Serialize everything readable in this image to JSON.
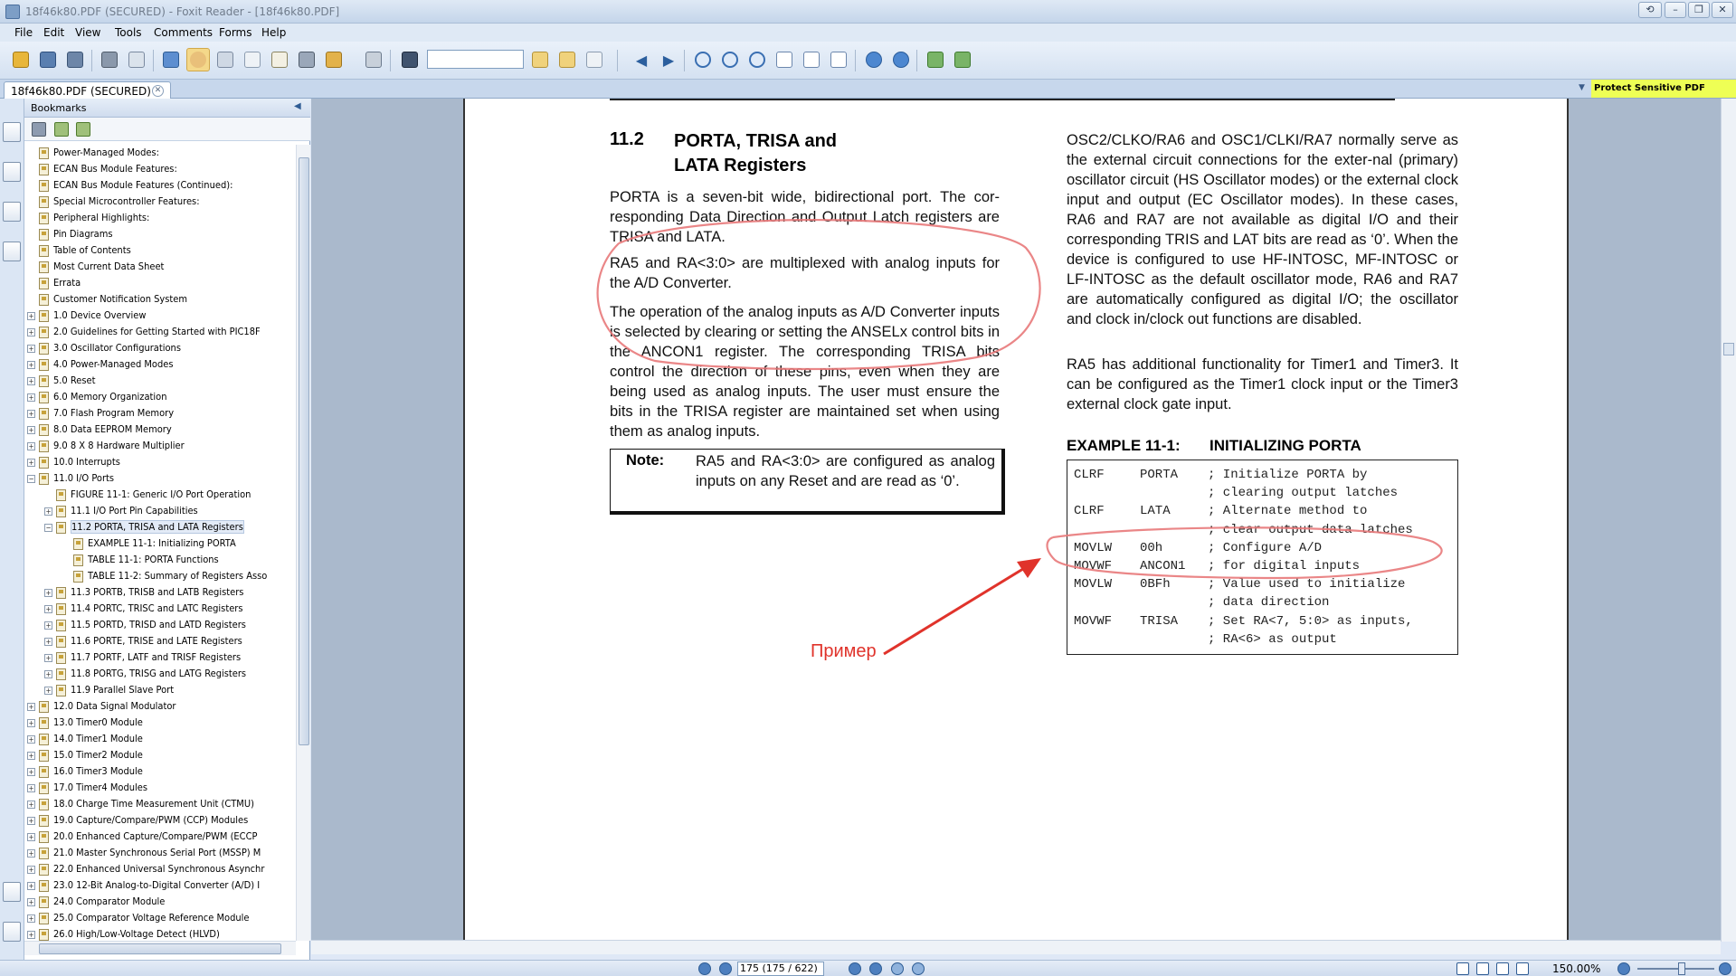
{
  "window": {
    "title": "18f46k80.PDF (SECURED) - Foxit Reader - [18f46k80.PDF]",
    "controls": [
      "⟲",
      "–",
      "❐",
      "✕"
    ]
  },
  "menu": [
    "File",
    "Edit",
    "View",
    "Tools",
    "Comments",
    "Forms",
    "Help"
  ],
  "tab": {
    "label": "18f46k80.PDF (SECURED)",
    "close": "✕",
    "dropdown": "▼"
  },
  "promo": "Protect Sensitive PDF Documents",
  "bookmarks": {
    "header": "Bookmarks",
    "items": [
      {
        "label": "Power-Managed Modes:",
        "level": 1,
        "exp": "",
        "sel": false
      },
      {
        "label": "ECAN Bus Module Features:",
        "level": 1,
        "exp": "",
        "sel": false
      },
      {
        "label": "ECAN Bus Module Features (Continued):",
        "level": 1,
        "exp": "",
        "sel": false
      },
      {
        "label": "Special Microcontroller Features:",
        "level": 1,
        "exp": "",
        "sel": false
      },
      {
        "label": "Peripheral Highlights:",
        "level": 1,
        "exp": "",
        "sel": false
      },
      {
        "label": "Pin Diagrams",
        "level": 1,
        "exp": "",
        "sel": false
      },
      {
        "label": "Table of Contents",
        "level": 1,
        "exp": "",
        "sel": false
      },
      {
        "label": "Most Current Data Sheet",
        "level": 1,
        "exp": "",
        "sel": false
      },
      {
        "label": "Errata",
        "level": 1,
        "exp": "",
        "sel": false
      },
      {
        "label": "Customer Notification System",
        "level": 1,
        "exp": "",
        "sel": false
      },
      {
        "label": "1.0 Device Overview",
        "level": 1,
        "exp": "+",
        "sel": false
      },
      {
        "label": "2.0 Guidelines for Getting Started with PIC18F",
        "level": 1,
        "exp": "+",
        "sel": false
      },
      {
        "label": "3.0 Oscillator Configurations",
        "level": 1,
        "exp": "+",
        "sel": false
      },
      {
        "label": "4.0 Power-Managed Modes",
        "level": 1,
        "exp": "+",
        "sel": false
      },
      {
        "label": "5.0 Reset",
        "level": 1,
        "exp": "+",
        "sel": false
      },
      {
        "label": "6.0 Memory Organization",
        "level": 1,
        "exp": "+",
        "sel": false
      },
      {
        "label": "7.0 Flash Program Memory",
        "level": 1,
        "exp": "+",
        "sel": false
      },
      {
        "label": "8.0 Data EEPROM Memory",
        "level": 1,
        "exp": "+",
        "sel": false
      },
      {
        "label": "9.0 8 X 8 Hardware Multiplier",
        "level": 1,
        "exp": "+",
        "sel": false
      },
      {
        "label": "10.0 Interrupts",
        "level": 1,
        "exp": "+",
        "sel": false
      },
      {
        "label": "11.0 I/O Ports",
        "level": 1,
        "exp": "−",
        "sel": false
      },
      {
        "label": "FIGURE 11-1: Generic I/O Port Operation",
        "level": 2,
        "exp": "",
        "sel": false
      },
      {
        "label": "11.1 I/O Port Pin Capabilities",
        "level": 2,
        "exp": "+",
        "sel": false
      },
      {
        "label": "11.2 PORTA, TRISA and LATA Registers",
        "level": 2,
        "exp": "−",
        "sel": true
      },
      {
        "label": "EXAMPLE 11-1: Initializing PORTA",
        "level": 3,
        "exp": "",
        "sel": false
      },
      {
        "label": "TABLE 11-1: PORTA Functions",
        "level": 3,
        "exp": "",
        "sel": false
      },
      {
        "label": "TABLE 11-2: Summary of Registers Asso",
        "level": 3,
        "exp": "",
        "sel": false
      },
      {
        "label": "11.3 PORTB, TRISB and LATB Registers",
        "level": 2,
        "exp": "+",
        "sel": false
      },
      {
        "label": "11.4 PORTC, TRISC and LATC Registers",
        "level": 2,
        "exp": "+",
        "sel": false
      },
      {
        "label": "11.5 PORTD, TRISD and LATD Registers",
        "level": 2,
        "exp": "+",
        "sel": false
      },
      {
        "label": "11.6 PORTE, TRISE and LATE Registers",
        "level": 2,
        "exp": "+",
        "sel": false
      },
      {
        "label": "11.7 PORTF, LATF and TRISF Registers",
        "level": 2,
        "exp": "+",
        "sel": false
      },
      {
        "label": "11.8 PORTG, TRISG and LATG Registers",
        "level": 2,
        "exp": "+",
        "sel": false
      },
      {
        "label": "11.9 Parallel Slave Port",
        "level": 2,
        "exp": "+",
        "sel": false
      },
      {
        "label": "12.0 Data Signal Modulator",
        "level": 1,
        "exp": "+",
        "sel": false
      },
      {
        "label": "13.0 Timer0 Module",
        "level": 1,
        "exp": "+",
        "sel": false
      },
      {
        "label": "14.0 Timer1 Module",
        "level": 1,
        "exp": "+",
        "sel": false
      },
      {
        "label": "15.0 Timer2 Module",
        "level": 1,
        "exp": "+",
        "sel": false
      },
      {
        "label": "16.0 Timer3 Module",
        "level": 1,
        "exp": "+",
        "sel": false
      },
      {
        "label": "17.0 Timer4 Modules",
        "level": 1,
        "exp": "+",
        "sel": false
      },
      {
        "label": "18.0 Charge Time Measurement Unit (CTMU)",
        "level": 1,
        "exp": "+",
        "sel": false
      },
      {
        "label": "19.0 Capture/Compare/PWM (CCP) Modules",
        "level": 1,
        "exp": "+",
        "sel": false
      },
      {
        "label": "20.0 Enhanced Capture/Compare/PWM (ECCP",
        "level": 1,
        "exp": "+",
        "sel": false
      },
      {
        "label": "21.0 Master Synchronous Serial Port (MSSP) M",
        "level": 1,
        "exp": "+",
        "sel": false
      },
      {
        "label": "22.0 Enhanced Universal Synchronous Asynchr",
        "level": 1,
        "exp": "+",
        "sel": false
      },
      {
        "label": "23.0 12-Bit Analog-to-Digital Converter (A/D) I",
        "level": 1,
        "exp": "+",
        "sel": false
      },
      {
        "label": "24.0 Comparator Module",
        "level": 1,
        "exp": "+",
        "sel": false
      },
      {
        "label": "25.0 Comparator Voltage Reference Module",
        "level": 1,
        "exp": "+",
        "sel": false
      },
      {
        "label": "26.0 High/Low-Voltage Detect (HLVD)",
        "level": 1,
        "exp": "+",
        "sel": false
      }
    ]
  },
  "document": {
    "heading_num": "11.2",
    "heading_line1": "PORTA, TRISA and",
    "heading_line2": "LATA Registers",
    "left_p1": "PORTA is a seven-bit wide, bidirectional port. The cor-responding Data Direction and Output Latch registers are TRISA and LATA.",
    "left_p2": "RA5 and RA<3:0> are multiplexed with analog inputs for the A/D Converter.",
    "left_p3": "The operation of the analog inputs as A/D Converter inputs is selected by clearing or setting the ANSELx control bits in the ANCON1 register. The corresponding TRISA bits control the direction of these pins, even when they are being used as analog inputs. The user must ensure the bits in the TRISA register are maintained set when using them as analog inputs.",
    "note_label": "Note:",
    "note_text": "RA5 and RA<3:0> are configured as analog inputs on any Reset and are read as ‘0’.",
    "right_p1": "OSC2/CLKO/RA6 and OSC1/CLKI/RA7 normally serve as the external circuit connections for the exter-nal (primary) oscillator circuit (HS Oscillator modes) or the external clock input and output (EC Oscillator modes). In these cases, RA6 and RA7 are not available as digital I/O and their corresponding TRIS and LAT bits are read as ‘0’. When the device is configured to use HF-INTOSC, MF-INTOSC or LF-INTOSC as the default oscillator mode, RA6 and RA7 are automatically configured as digital I/O; the oscillator and clock in/clock out functions are disabled.",
    "right_p2": "RA5 has additional functionality for Timer1 and Timer3. It can be configured as the Timer1 clock input or the Timer3 external clock gate input.",
    "example_label": "EXAMPLE 11-1:",
    "example_title": "INITIALIZING PORTA",
    "code": [
      {
        "op": "CLRF",
        "arg": "PORTA",
        "cmt": "; Initialize PORTA by"
      },
      {
        "op": "",
        "arg": "",
        "cmt": "; clearing output latches"
      },
      {
        "op": "CLRF",
        "arg": "LATA",
        "cmt": "; Alternate method to"
      },
      {
        "op": "",
        "arg": "",
        "cmt": "; clear output data latches"
      },
      {
        "op": "MOVLW",
        "arg": "00h",
        "cmt": "; Configure A/D"
      },
      {
        "op": "MOVWF",
        "arg": "ANCON1",
        "cmt": "; for digital inputs"
      },
      {
        "op": "MOVLW",
        "arg": "0BFh",
        "cmt": "; Value used to initialize"
      },
      {
        "op": "",
        "arg": "",
        "cmt": "; data direction"
      },
      {
        "op": "MOVWF",
        "arg": "TRISA",
        "cmt": "; Set RA<7, 5:0> as inputs,"
      },
      {
        "op": "",
        "arg": "",
        "cmt": "; RA<6> as output"
      }
    ],
    "annotation": "Пример",
    "annotation_color": "#e0332b"
  },
  "status": {
    "page_display": "175 (175 / 622)",
    "zoom": "150.00%"
  }
}
